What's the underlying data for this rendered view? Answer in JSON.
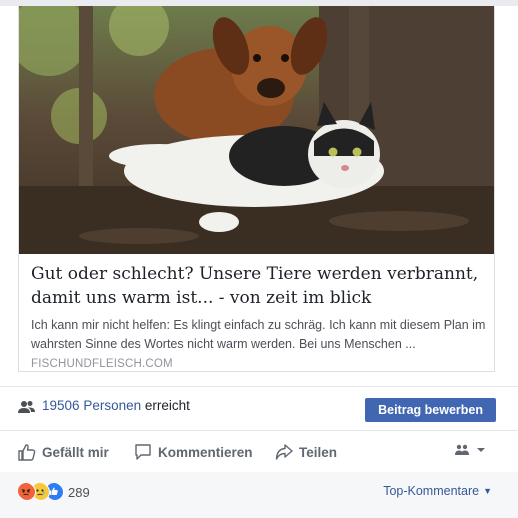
{
  "link_preview": {
    "title": "Gut oder schlecht? Unsere Tiere werden verbrannt, damit uns warm ist... - von zeit im blick",
    "description": "Ich kann mir nicht helfen: Es klingt einfach zu schräg. Ich kann mit diesem Plan im wahrsten Sinne des Wortes nicht warm werden. Bei uns Menschen ...",
    "domain": "FISCHUNDFLEISCH.COM",
    "image_icon": "dog-and-cat-photo"
  },
  "reach": {
    "count": "19506",
    "people_label": "Personen",
    "suffix": "erreicht",
    "icon": "people-icon",
    "boost_label": "Beitrag bewerben"
  },
  "actions": {
    "like_label": "Gefällt mir",
    "comment_label": "Kommentieren",
    "share_label": "Teilen",
    "audience_icon": "friends-icon"
  },
  "footer": {
    "reaction_icons": [
      "angry-icon",
      "sad-icon",
      "like-icon"
    ],
    "reaction_count": "289",
    "sort_label": "Top-Kommentare"
  },
  "colors": {
    "link_blue": "#365899",
    "button_blue": "#4267b2",
    "muted_gray": "#606770"
  }
}
